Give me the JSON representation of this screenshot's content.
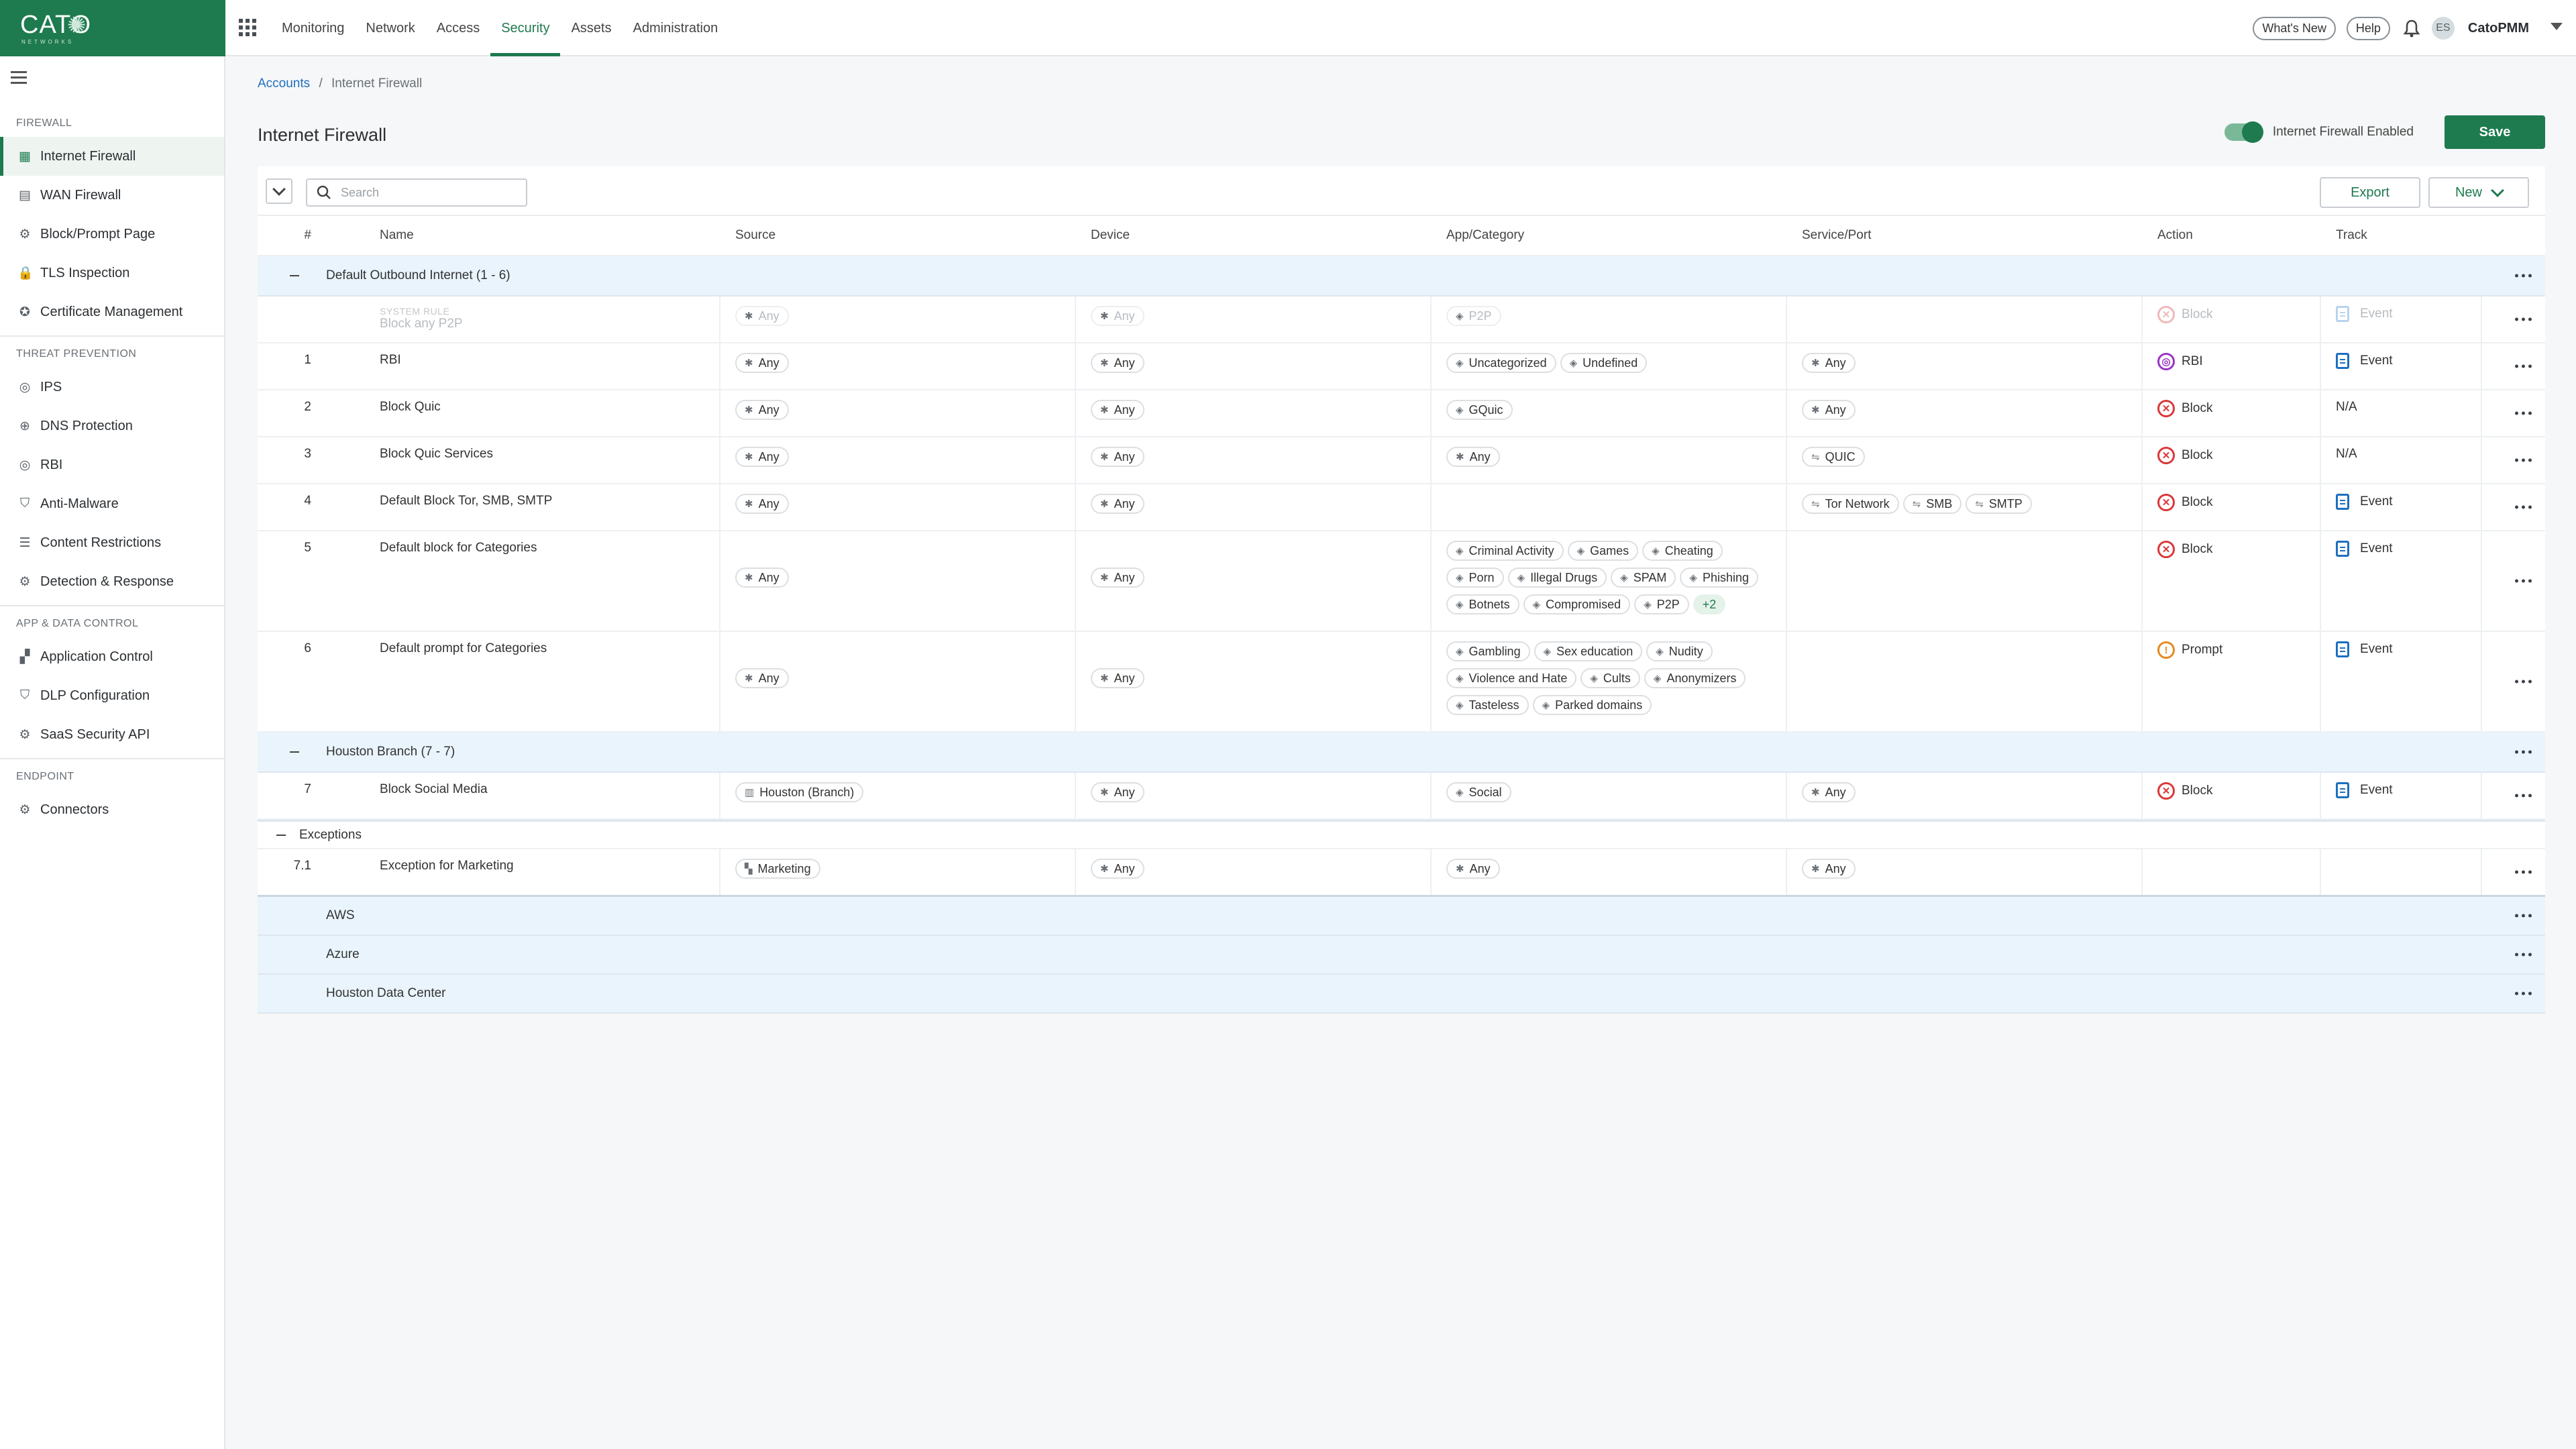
{
  "brand": {
    "logo_text": "CATO",
    "logo_sub": "NETWORKS"
  },
  "topnav": {
    "items": [
      "Monitoring",
      "Network",
      "Access",
      "Security",
      "Assets",
      "Administration"
    ],
    "active": "Security",
    "whats_new": "What's New",
    "help": "Help",
    "avatar_initials": "ES",
    "account_name": "CatoPMM"
  },
  "sidebar": {
    "sections": [
      {
        "title": "FIREWALL",
        "items": [
          {
            "label": "Internet Firewall",
            "icon": "firewall-icon",
            "active": true
          },
          {
            "label": "WAN Firewall",
            "icon": "wan-firewall-icon"
          },
          {
            "label": "Block/Prompt Page",
            "icon": "gear-icon"
          },
          {
            "label": "TLS Inspection",
            "icon": "lock-icon"
          },
          {
            "label": "Certificate Management",
            "icon": "certificate-icon"
          }
        ]
      },
      {
        "title": "THREAT PREVENTION",
        "items": [
          {
            "label": "IPS",
            "icon": "target-icon"
          },
          {
            "label": "DNS Protection",
            "icon": "globe-icon"
          },
          {
            "label": "RBI",
            "icon": "target-icon"
          },
          {
            "label": "Anti-Malware",
            "icon": "shield-icon"
          },
          {
            "label": "Content Restrictions",
            "icon": "list-icon"
          },
          {
            "label": "Detection & Response",
            "icon": "gear-icon"
          }
        ]
      },
      {
        "title": "APP & DATA CONTROL",
        "items": [
          {
            "label": "Application Control",
            "icon": "apps-icon"
          },
          {
            "label": "DLP Configuration",
            "icon": "shield-icon"
          },
          {
            "label": "SaaS Security API",
            "icon": "gear-icon"
          }
        ]
      },
      {
        "title": "ENDPOINT",
        "items": [
          {
            "label": "Connectors",
            "icon": "connector-icon"
          }
        ]
      }
    ]
  },
  "breadcrumb": {
    "root": "Accounts",
    "separator": "/",
    "current": "Internet Firewall"
  },
  "page": {
    "title": "Internet Firewall",
    "toggle_label": "Internet Firewall Enabled",
    "toggle_on": true,
    "save_label": "Save",
    "search_placeholder": "Search",
    "export_label": "Export",
    "new_label": "New"
  },
  "columns": [
    "#",
    "Name",
    "Source",
    "Device",
    "App/Category",
    "Service/Port",
    "Action",
    "Track"
  ],
  "colors": {
    "brand": "#1e7a4f",
    "block": "#d9393b",
    "rbi": "#9b34c3",
    "prompt": "#e58a1f",
    "track": "#1e6fbf",
    "section_bg": "#e9f4fc"
  },
  "sections": [
    {
      "label": "Default Outbound Internet (1 - 6)",
      "system_rule": {
        "tag": "SYSTEM RULE",
        "name": "Block any P2P",
        "source": [
          "Any"
        ],
        "device": [
          "Any"
        ],
        "app": [
          "P2P"
        ],
        "service": [],
        "action": "Block",
        "track": "Event"
      },
      "rules": [
        {
          "num": "1",
          "name": "RBI",
          "source": [
            "Any"
          ],
          "device": [
            "Any"
          ],
          "app": [
            "Uncategorized",
            "Undefined"
          ],
          "service": [
            "Any"
          ],
          "action": "RBI",
          "action_type": "rbi",
          "track": "Event"
        },
        {
          "num": "2",
          "name": "Block Quic",
          "source": [
            "Any"
          ],
          "device": [
            "Any"
          ],
          "app": [
            "GQuic"
          ],
          "service": [
            "Any"
          ],
          "action": "Block",
          "action_type": "block",
          "track": "N/A"
        },
        {
          "num": "3",
          "name": "Block Quic Services",
          "source": [
            "Any"
          ],
          "device": [
            "Any"
          ],
          "app": [
            "Any"
          ],
          "service": [
            "QUIC"
          ],
          "action": "Block",
          "action_type": "block",
          "track": "N/A"
        },
        {
          "num": "4",
          "name": "Default Block Tor, SMB, SMTP",
          "source": [
            "Any"
          ],
          "device": [
            "Any"
          ],
          "app": [],
          "service": [
            "Tor Network",
            "SMB",
            "SMTP"
          ],
          "action": "Block",
          "action_type": "block",
          "track": "Event"
        },
        {
          "num": "5",
          "name": "Default block for Categories",
          "source": [
            "Any"
          ],
          "device": [
            "Any"
          ],
          "app": [
            "Criminal Activity",
            "Games",
            "Cheating",
            "Porn",
            "Illegal Drugs",
            "SPAM",
            "Phishing",
            "Botnets",
            "Compromised",
            "P2P"
          ],
          "app_more": "+2",
          "service": [],
          "action": "Block",
          "action_type": "block",
          "track": "Event"
        },
        {
          "num": "6",
          "name": "Default prompt for Categories",
          "source": [
            "Any"
          ],
          "device": [
            "Any"
          ],
          "app": [
            "Gambling",
            "Sex education",
            "Nudity",
            "Violence and Hate",
            "Cults",
            "Anonymizers",
            "Tasteless",
            "Parked domains"
          ],
          "service": [],
          "action": "Prompt",
          "action_type": "prompt",
          "track": "Event"
        }
      ]
    },
    {
      "label": "Houston Branch (7 - 7)",
      "rules": [
        {
          "num": "7",
          "name": "Block Social Media",
          "source": [
            "Houston (Branch)"
          ],
          "device": [
            "Any"
          ],
          "app": [
            "Social"
          ],
          "service": [
            "Any"
          ],
          "action": "Block",
          "action_type": "block",
          "track": "Event"
        }
      ],
      "exceptions_label": "Exceptions",
      "exceptions": [
        {
          "num": "7.1",
          "name": "Exception for Marketing",
          "source": [
            "Marketing"
          ],
          "device": [
            "Any"
          ],
          "app": [
            "Any"
          ],
          "service": [
            "Any"
          ],
          "action": "",
          "track": ""
        }
      ]
    }
  ],
  "groups": [
    "AWS",
    "Azure",
    "Houston Data Center"
  ]
}
